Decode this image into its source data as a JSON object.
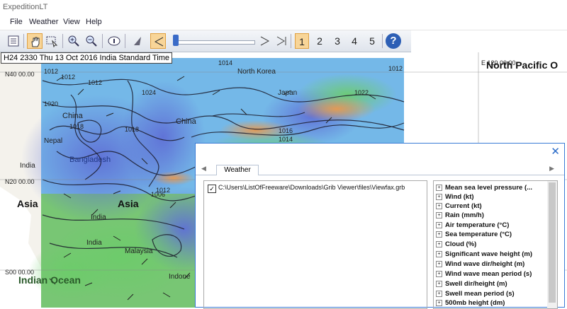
{
  "window": {
    "title": "ExpeditionLT"
  },
  "menu": [
    "File",
    "Weather",
    "View",
    "Help"
  ],
  "toolbar": {
    "frames": [
      "1",
      "2",
      "3",
      "4",
      "5"
    ],
    "active_frame": "1",
    "help_label": "?"
  },
  "status": "H24 2330 Thu 13 Oct 2016 India Standard Time",
  "map": {
    "lat_labels": [
      "N40 00.00",
      "N20 00.00",
      "S00 00.00"
    ],
    "lon_labels": [
      "E 120 00.00"
    ],
    "regions": [
      "North Pacific O",
      "Asia",
      "Asia",
      "Indian Ocean"
    ],
    "places": [
      "China",
      "China",
      "India",
      "India",
      "India",
      "Nepal",
      "Bangladesh",
      "North Korea",
      "Malaysia",
      "Indone",
      "Japan"
    ],
    "isobars": [
      "1012",
      "1012",
      "1012",
      "1020",
      "1018",
      "1018",
      "1024",
      "1012",
      "1016",
      "1014",
      "1022",
      "1006",
      "1012",
      "1014"
    ],
    "colors": {
      "wind_low": "#5aa0e0",
      "wind_mid": "#64c864",
      "wind_high": "#e09050",
      "calm": "#6a78d8"
    }
  },
  "panel": {
    "tab": "Weather",
    "file_checked": true,
    "file_path": "C:\\Users\\ListOfFreeware\\Downloads\\Grib Viewer\\files\\Viewfax.grb",
    "layers": [
      "Mean sea level pressure (...",
      "Wind (kt)",
      "Current (kt)",
      "Rain (mm/h)",
      "Air temperature (°C)",
      "Sea temperature (°C)",
      "Cloud (%)",
      "Significant wave height (m)",
      "Wind wave dir/height (m)",
      "Wind wave mean period (s)",
      "Swell dir/height (m)",
      "Swell mean period (s)",
      "500mb height (dm)"
    ]
  }
}
